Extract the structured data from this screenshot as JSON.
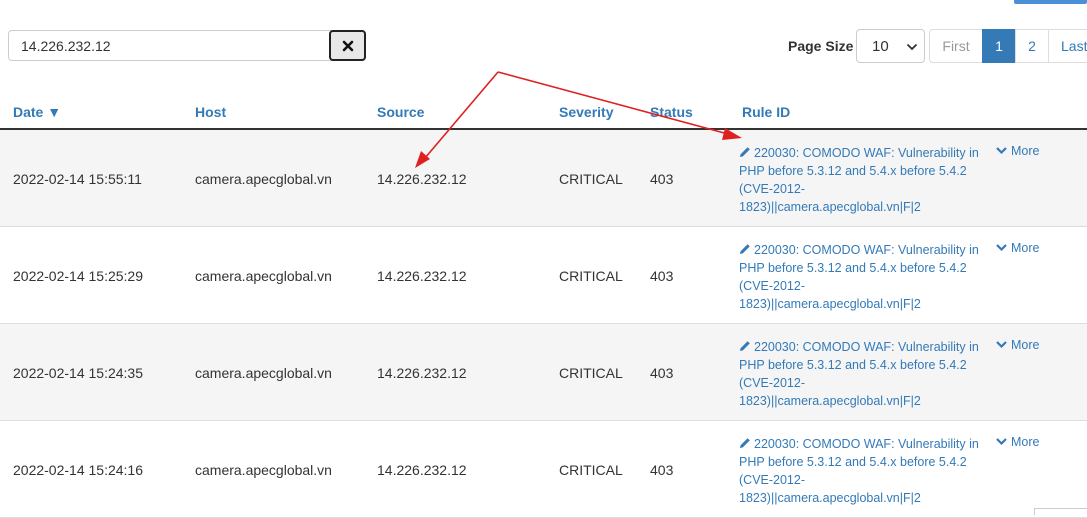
{
  "search": {
    "value": "14.226.232.12"
  },
  "page_size": {
    "label": "Page Size",
    "selected": "10"
  },
  "pagination": {
    "first": "First",
    "pages": [
      "1",
      "2"
    ],
    "last": "Last",
    "active": "1"
  },
  "columns": {
    "date": "Date ▼",
    "host": "Host",
    "source": "Source",
    "severity": "Severity",
    "status": "Status",
    "rule_id": "Rule ID"
  },
  "rows": [
    {
      "date": "2022-02-14 15:55:11",
      "host": "camera.apecglobal.vn",
      "source": "14.226.232.12",
      "severity": "CRITICAL",
      "status": "403",
      "rule": "220030: COMODO WAF: Vulnerability in PHP before 5.3.12 and 5.4.x before 5.4.2 (CVE-2012-1823)||camera.apecglobal.vn|F|2",
      "more": "More"
    },
    {
      "date": "2022-02-14 15:25:29",
      "host": "camera.apecglobal.vn",
      "source": "14.226.232.12",
      "severity": "CRITICAL",
      "status": "403",
      "rule": "220030: COMODO WAF: Vulnerability in PHP before 5.3.12 and 5.4.x before 5.4.2 (CVE-2012-1823)||camera.apecglobal.vn|F|2",
      "more": "More"
    },
    {
      "date": "2022-02-14 15:24:35",
      "host": "camera.apecglobal.vn",
      "source": "14.226.232.12",
      "severity": "CRITICAL",
      "status": "403",
      "rule": "220030: COMODO WAF: Vulnerability in PHP before 5.3.12 and 5.4.x before 5.4.2 (CVE-2012-1823)||camera.apecglobal.vn|F|2",
      "more": "More"
    },
    {
      "date": "2022-02-14 15:24:16",
      "host": "camera.apecglobal.vn",
      "source": "14.226.232.12",
      "severity": "CRITICAL",
      "status": "403",
      "rule": "220030: COMODO WAF: Vulnerability in PHP before 5.3.12 and 5.4.x before 5.4.2 (CVE-2012-1823)||camera.apecglobal.vn|F|2",
      "more": "More"
    }
  ],
  "colors": {
    "link": "#337ab7",
    "active_page": "#337ab7",
    "annotation_arrow": "#e02020",
    "row_alt": "#f5f5f5"
  },
  "icons": {
    "clear": "close-icon",
    "rule": "pencil-icon",
    "more": "chevron-down-icon",
    "select": "chevron-down-icon"
  }
}
